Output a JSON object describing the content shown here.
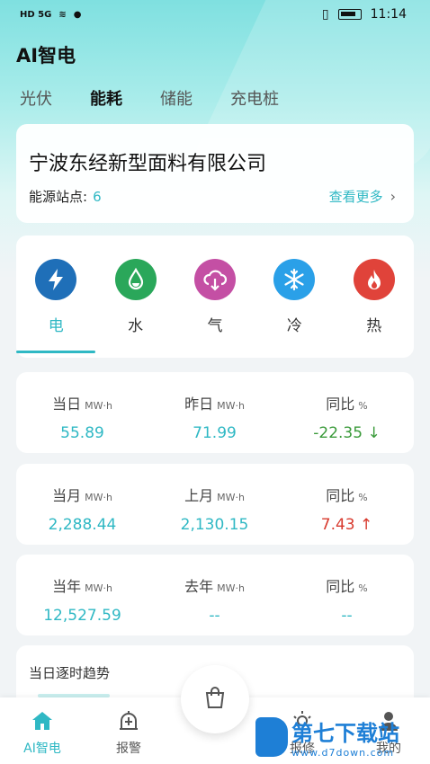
{
  "status_bar": {
    "time": "11:14",
    "left_indicators": "HD 5G"
  },
  "app_title": "AI智电",
  "top_tabs": [
    "光伏",
    "能耗",
    "储能",
    "充电桩"
  ],
  "active_tab": "能耗",
  "company": {
    "name": "宁波东经新型面料有限公司",
    "station_label": "能源站点:",
    "station_count": "6",
    "more_label": "查看更多"
  },
  "energy_types": [
    {
      "label": "电",
      "icon": "lightning-icon",
      "color": "#1f6fb8"
    },
    {
      "label": "水",
      "icon": "water-drop-icon",
      "color": "#2aa75a"
    },
    {
      "label": "气",
      "icon": "gas-cloud-icon",
      "color": "#c44fa4"
    },
    {
      "label": "冷",
      "icon": "snowflake-icon",
      "color": "#2aa0e8"
    },
    {
      "label": "热",
      "icon": "flame-icon",
      "color": "#e0433a"
    }
  ],
  "active_energy": "电",
  "stats": [
    {
      "a_label": "当日",
      "a_unit": "MW·h",
      "a_value": "55.89",
      "b_label": "昨日",
      "b_unit": "MW·h",
      "b_value": "71.99",
      "c_label": "同比",
      "c_unit": "%",
      "c_value": "-22.35 ↓"
    },
    {
      "a_label": "当月",
      "a_unit": "MW·h",
      "a_value": "2,288.44",
      "b_label": "上月",
      "b_unit": "MW·h",
      "b_value": "2,130.15",
      "c_label": "同比",
      "c_unit": "%",
      "c_value": "7.43 ↑"
    },
    {
      "a_label": "当年",
      "a_unit": "MW·h",
      "a_value": "12,527.59",
      "b_label": "去年",
      "b_unit": "MW·h",
      "b_value": "--",
      "c_label": "同比",
      "c_unit": "%",
      "c_value": "--"
    }
  ],
  "trend_title": "当日逐时趋势",
  "bottom_nav": [
    {
      "label": "AI智电",
      "icon": "home-icon"
    },
    {
      "label": "报警",
      "icon": "alarm-icon"
    },
    {
      "label": "报修",
      "icon": "repair-icon"
    },
    {
      "label": "我的",
      "icon": "profile-icon"
    }
  ],
  "center_button_icon": "shopping-bag-icon",
  "watermark": {
    "title": "第七下载站",
    "url": "www.d7down.com"
  },
  "colors": {
    "accent": "#2fb8c4",
    "down": "#3a9a3a",
    "up": "#d83a2e"
  }
}
